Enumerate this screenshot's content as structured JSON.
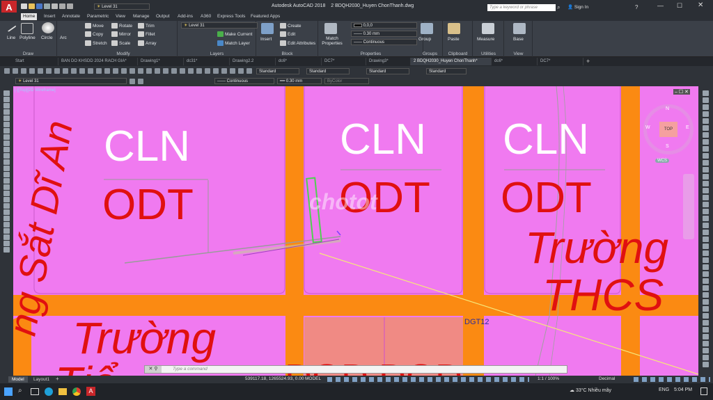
{
  "app": {
    "title": "Autodesk AutoCAD 2018",
    "document": "2 BDQH2030_Huyen ChonThanh.dwg",
    "search_placeholder": "Type a keyword or phrase",
    "sign_in": "Sign In"
  },
  "ribbon_tabs": [
    "Home",
    "Insert",
    "Annotate",
    "Parametric",
    "View",
    "Manage",
    "Output",
    "Add-ins",
    "A360",
    "Express Tools",
    "Featured Apps"
  ],
  "quick_access_layer": "Level 31",
  "panels": {
    "draw": {
      "title": "Draw",
      "line": "Line",
      "polyline": "Polyline",
      "circle": "Circle",
      "arc": "Arc"
    },
    "modify": {
      "title": "Modify",
      "move": "Move",
      "rotate": "Rotate",
      "trim": "Trim",
      "copy": "Copy",
      "mirror": "Mirror",
      "fillet": "Fillet",
      "stretch": "Stretch",
      "scale": "Scale",
      "array": "Array"
    },
    "layers": {
      "title": "Layers",
      "current_layer": "Level 31",
      "make_current": "Make Current",
      "match_layer": "Match Layer"
    },
    "block": {
      "title": "Block",
      "insert": "Insert",
      "create": "Create",
      "edit": "Edit",
      "edit_attributes": "Edit Attributes"
    },
    "properties": {
      "title": "Properties",
      "match_properties": "Match Properties",
      "color_value": "0,0,0",
      "lineweight": "0.30 mm",
      "linetype": "Continuous"
    },
    "groups": {
      "title": "Groups",
      "group": "Group"
    },
    "clipboard": {
      "title": "Clipboard",
      "paste": "Paste"
    },
    "utilities": {
      "title": "Utilities",
      "measure": "Measure"
    },
    "view": {
      "title": "View",
      "base": "Base"
    }
  },
  "doc_tabs": [
    "Start",
    "BAN DO KHSDD 2024 RACH GIA*",
    "Drawing1*",
    "dc31*",
    "Drawing2.2",
    "dc6*",
    "DC7*",
    "Drawing3*",
    "2 BDQH2030_Huyen ChonThanh*",
    "dc6*",
    "DC7*"
  ],
  "toolbar": {
    "styles": [
      "Standard",
      "Standard",
      "Standard",
      "Standard"
    ],
    "layer": "Level 31",
    "linetype": "Continuous",
    "lineweight": "0.30 mm",
    "color": "ByColor"
  },
  "viewport_label": "[-][Top][2D Wireframe]",
  "viewcube": {
    "top": "TOP",
    "n": "N",
    "s": "S",
    "e": "E",
    "w": "W",
    "ucs": "WCS"
  },
  "drawing_texts": {
    "cln1": "CLN",
    "odt1": "ODT",
    "cln2": "CLN",
    "odt2": "ODT",
    "cln3": "CLN",
    "odt3": "ODT",
    "school1_line1": "Trường",
    "school1_line2": "THCS",
    "school2_line1": "Trường",
    "school2_line2": "Tiể",
    "road_label": "DGT12",
    "left_vertical": "ng Sắt Dĩ An",
    "bottom_partial": "DGD DGD",
    "watermark": "chotot"
  },
  "command_placeholder": "Type a command",
  "layout_tabs": [
    "Model",
    "Layout1"
  ],
  "status": {
    "coords": "539117.18, 1265524.93, 0.00",
    "model": "MODEL",
    "scale": "1:1 / 100%",
    "units": "Decimal"
  },
  "taskbar": {
    "weather_temp": "33°C",
    "weather_text": "Nhiều mây",
    "language": "ENG",
    "time": "5:04 PM"
  },
  "colors": {
    "pink": "#f07af0",
    "orange": "#fb8a12",
    "salmon": "#f08a84",
    "red_text": "#e01010",
    "ribbon": "#3b4048"
  }
}
